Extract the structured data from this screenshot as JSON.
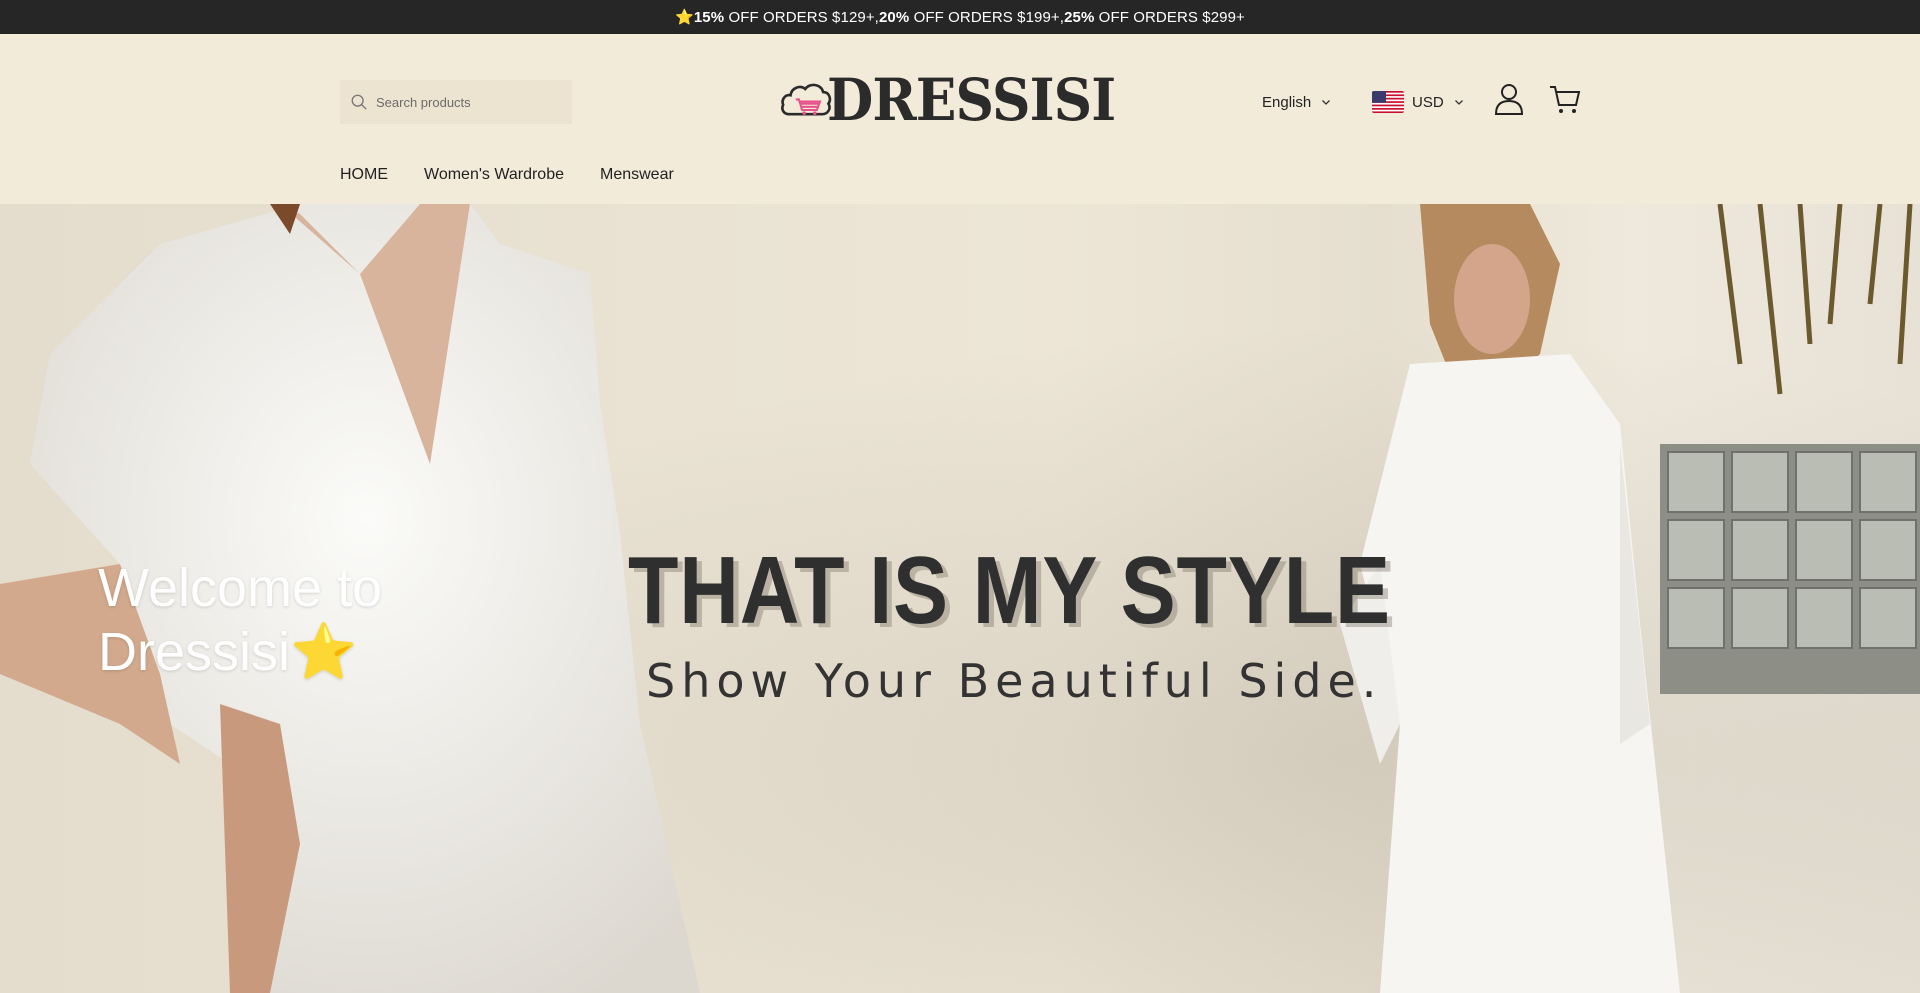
{
  "announcement": {
    "prefix": "⭐",
    "offer1_pct": "15%",
    "offer1_rest": " OFF ORDERS $129+,",
    "offer2_pct": "20%",
    "offer2_rest": " OFF ORDERS $199+,",
    "offer3_pct": "25%",
    "offer3_rest": " OFF ORDERS $299+"
  },
  "header": {
    "search_placeholder": "Search products",
    "logo_text": "DRESSISI",
    "language": "English",
    "currency": "USD",
    "icons": [
      "search-icon",
      "logo-cart-cloud-icon",
      "chevron-down-icon",
      "us-flag-icon",
      "account-icon",
      "cart-icon"
    ]
  },
  "nav": {
    "items": [
      "HOME",
      "Women's Wardrobe",
      "Menswear"
    ]
  },
  "hero": {
    "welcome_line1": "Welcome to",
    "welcome_line2": "Dressisi⭐",
    "headline": "THAT IS MY STYLE",
    "subline": "Show Your Beautiful Side."
  },
  "colors": {
    "announcement_bg": "#262626",
    "header_bg": "#f2ebd9",
    "logo_pink": "#e8528a",
    "text_dark": "#222222"
  }
}
